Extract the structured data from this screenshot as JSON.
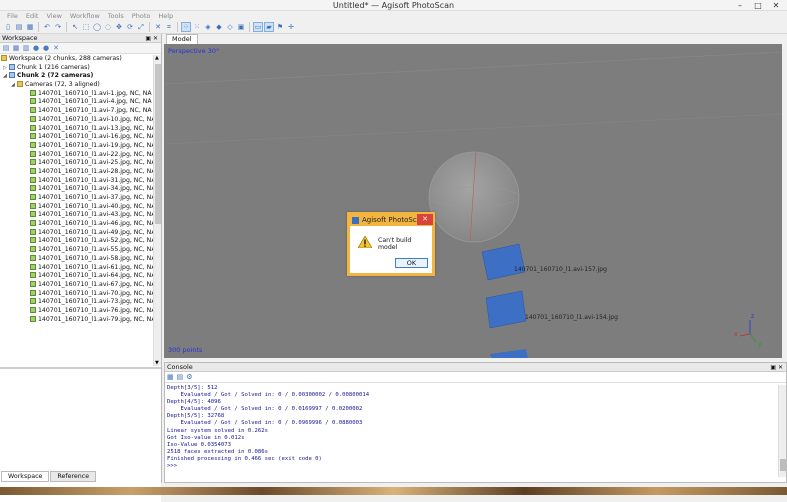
{
  "window": {
    "title": "Untitled* — Agisoft PhotoScan",
    "min": "–",
    "max": "□",
    "close": "✕"
  },
  "menu": [
    "File",
    "Edit",
    "View",
    "Workflow",
    "Tools",
    "Photo",
    "Help"
  ],
  "workspace": {
    "header": "Workspace",
    "header_ctrl": "▣ ✕",
    "root": "Workspace (2 chunks, 288 cameras)",
    "chunk1": "Chunk 1 (216 cameras)",
    "chunk2": "Chunk 2 (72 cameras)",
    "cameras_folder": "Cameras (72, 3 aligned)",
    "cameras": [
      "140701_160710_l1.avi-1.jpg, NC, NA",
      "140701_160710_l1.avi-4.jpg, NC, NA",
      "140701_160710_l1.avi-7.jpg, NC, NA",
      "140701_160710_l1.avi-10.jpg, NC, NA",
      "140701_160710_l1.avi-13.jpg, NC, NA",
      "140701_160710_l1.avi-16.jpg, NC, NA",
      "140701_160710_l1.avi-19.jpg, NC, NA",
      "140701_160710_l1.avi-22.jpg, NC, NA",
      "140701_160710_l1.avi-25.jpg, NC, NA",
      "140701_160710_l1.avi-28.jpg, NC, NA",
      "140701_160710_l1.avi-31.jpg, NC, NA",
      "140701_160710_l1.avi-34.jpg, NC, NA",
      "140701_160710_l1.avi-37.jpg, NC, NA",
      "140701_160710_l1.avi-40.jpg, NC, NA",
      "140701_160710_l1.avi-43.jpg, NC, NA",
      "140701_160710_l1.avi-46.jpg, NC, NA",
      "140701_160710_l1.avi-49.jpg, NC, NA",
      "140701_160710_l1.avi-52.jpg, NC, NA",
      "140701_160710_l1.avi-55.jpg, NC, NA",
      "140701_160710_l1.avi-58.jpg, NC, NA",
      "140701_160710_l1.avi-61.jpg, NC, NA",
      "140701_160710_l1.avi-64.jpg, NC, NA",
      "140701_160710_l1.avi-67.jpg, NC, NA",
      "140701_160710_l1.avi-70.jpg, NC, NA",
      "140701_160710_l1.avi-73.jpg, NC, NA",
      "140701_160710_l1.avi-76.jpg, NC, NA",
      "140701_160710_l1.avi-79.jpg, NC, NA"
    ],
    "tabs": [
      "Workspace",
      "Reference"
    ]
  },
  "model": {
    "tab": "Model",
    "view_label": "Perspective 30°",
    "points_label": "300 points",
    "camera_labels": [
      "140701_160710_l1.avi-157.jpg",
      "140701_160710_l1.avi-154.jpg"
    ],
    "axes": {
      "z": "z",
      "x": "x",
      "y": "y"
    }
  },
  "dialog": {
    "title": "Agisoft PhotoSc...",
    "message": "Can't build model",
    "ok": "OK",
    "close": "✕"
  },
  "console": {
    "header": "Console",
    "header_ctrl": "▣ ✕",
    "log": [
      "Depth[3/5]: 512",
      "    Evaluated / Got / Solved in: 0 / 0.00300002 / 0.00800014",
      "Depth[4/5]: 4096",
      "    Evaluated / Got / Solved in: 0 / 0.0169997 / 0.0200002",
      "Depth[5/5]: 32768",
      "    Evaluated / Got / Solved in: 0 / 0.0969996 / 0.0880003",
      "Linear system solved in 0.262s",
      "Got Iso-value in 0.012s",
      "Iso-Value 0.0354073",
      "2518 faces extracted in 0.086s",
      "Finished processing in 0.466 sec (exit code 0)",
      ">>>"
    ]
  },
  "colors": {
    "dialog_accent": "#f2b640",
    "viewport_bg": "#7d7d7d",
    "camera_plane": "#3d6fc4",
    "console_text": "#141494"
  }
}
